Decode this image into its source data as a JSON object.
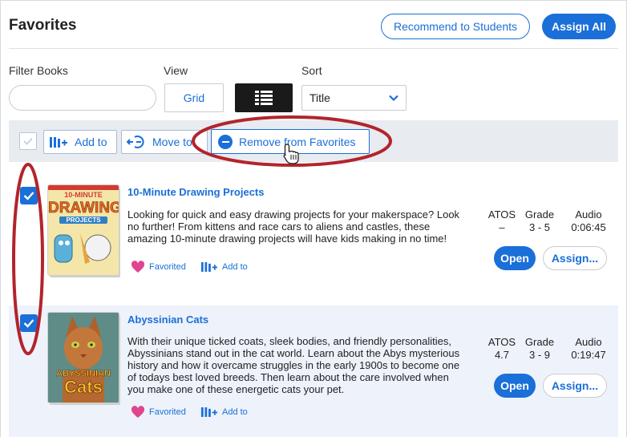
{
  "header": {
    "title": "Favorites",
    "recommend_label": "Recommend to Students",
    "assign_all_label": "Assign All"
  },
  "filters": {
    "filter_label": "Filter Books",
    "filter_value": "",
    "view_label": "View",
    "grid_label": "Grid",
    "sort_label": "Sort",
    "sort_value": "Title"
  },
  "toolbar": {
    "add_to_label": "Add to",
    "move_to_label": "Move to",
    "remove_label": "Remove from Favorites"
  },
  "books": [
    {
      "title": "10-Minute Drawing Projects",
      "description": "Looking for quick and easy drawing projects for your makerspace? Look no further! From kittens and race cars to aliens and castles, these amazing 10-minute drawing projects will have kids making in no time!",
      "atos_label": "ATOS",
      "atos": "–",
      "grade_label": "Grade",
      "grade": "3 - 5",
      "audio_label": "Audio",
      "audio": "0:06:45",
      "open_label": "Open",
      "assign_label": "Assign...",
      "favorited_label": "Favorited",
      "add_to_label": "Add to",
      "cover_line1": "10-MINUTE",
      "cover_line2": "DRAWING",
      "cover_line3": "PROJECTS"
    },
    {
      "title": "Abyssinian Cats",
      "description": "With their unique ticked coats, sleek bodies, and friendly personalities, Abyssinians stand out in the cat world. Learn about the Abys mysterious history and how it overcame struggles in the early 1900s to become one of todays best loved breeds. Then learn about the care involved when you make one of these energetic cats your pet.",
      "atos_label": "ATOS",
      "atos": "4.7",
      "grade_label": "Grade",
      "grade": "3 - 9",
      "audio_label": "Audio",
      "audio": "0:19:47",
      "open_label": "Open",
      "assign_label": "Assign...",
      "favorited_label": "Favorited",
      "add_to_label": "Add to",
      "cover_line1": "ABYSSINIAN",
      "cover_line2": "Cats"
    }
  ],
  "colors": {
    "accent": "#1a6fd8",
    "annotation": "#b3242c",
    "heart": "#e0458f"
  }
}
